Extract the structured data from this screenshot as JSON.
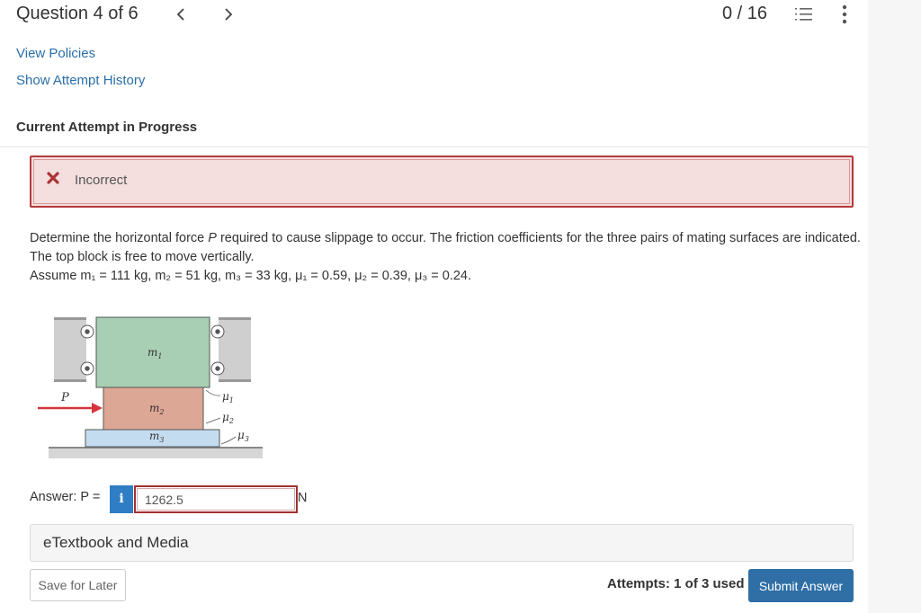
{
  "header": {
    "question_title": "Question 4 of 6",
    "prev_icon": "chevron-left-icon",
    "next_icon": "chevron-right-icon",
    "score": "0 / 16",
    "list_icon": "numbered-list-icon",
    "more_icon": "more-vertical-icon"
  },
  "links": {
    "view_policies": "View Policies",
    "attempt_history": "Show Attempt History"
  },
  "section_title": "Current Attempt in Progress",
  "alert": {
    "status": "Incorrect",
    "icon": "x-icon",
    "color": "#b73a3a"
  },
  "problem": {
    "line1_a": "Determine the horizontal force ",
    "line1_p": "P",
    "line1_b": " required to cause slippage to occur. The friction coefficients for the three pairs of mating surfaces are indicated. The top block is free to move vertically.",
    "line2": "Assume m₁ = 111 kg, m₂ = 51 kg, m₃ = 33 kg, μ₁ = 0.59, μ₂ = 0.39, μ₃ = 0.24."
  },
  "figure": {
    "label_p": "P",
    "label_m1": "m",
    "label_m2": "m",
    "label_m3": "m",
    "sub_1": "1",
    "sub_2": "2",
    "sub_3": "3",
    "mu": "μ"
  },
  "answer": {
    "label": "Answer: P =",
    "info_label": "i",
    "value": "1262.5",
    "unit": "N"
  },
  "etextbook": "eTextbook and Media",
  "footer": {
    "save_label": "Save for Later",
    "attempts": "Attempts: 1 of 3 used",
    "submit_label": "Submit Answer"
  }
}
